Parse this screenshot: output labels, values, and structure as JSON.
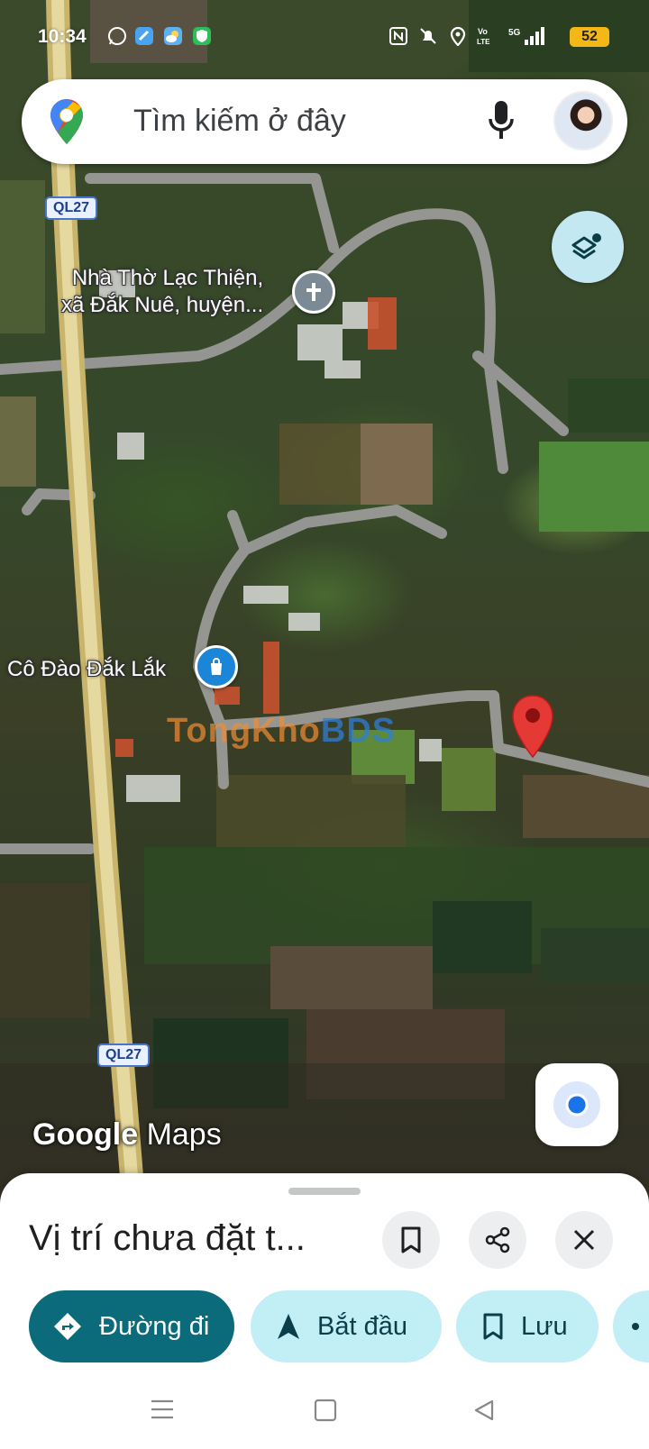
{
  "status_bar": {
    "time": "10:34",
    "battery": "52",
    "icons": [
      "whatsapp-icon",
      "app-icon",
      "weather-icon",
      "shield-app-icon",
      "nfc-icon",
      "mute-icon",
      "location-icon",
      "volte-icon",
      "5g-signal-icon"
    ]
  },
  "search": {
    "placeholder": "Tìm kiếm ở đây"
  },
  "map": {
    "road_shields": [
      "QL27",
      "QL27"
    ],
    "labels": {
      "church": "Nhà Thờ Lạc Thiện,\nxã Đắk Nuê, huyện...",
      "shop": "Cô Đào Đắk Lắk"
    },
    "watermark": {
      "part1": "TongKho",
      "part2": "BDS"
    },
    "logo": {
      "google": "Google",
      "maps": "Maps"
    }
  },
  "sheet": {
    "title": "Vị trí chưa đặt t...",
    "chips": [
      {
        "label": "Đường đi",
        "icon": "directions-icon"
      },
      {
        "label": "Bắt đầu",
        "icon": "navigation-arrow-icon"
      },
      {
        "label": "Lưu",
        "icon": "bookmark-icon"
      }
    ]
  },
  "colors": {
    "primary_chip": "#0b6b7a",
    "tonal_chip": "#c2eef6",
    "pin_red": "#e53935",
    "poi_blue": "#1b86d8"
  }
}
